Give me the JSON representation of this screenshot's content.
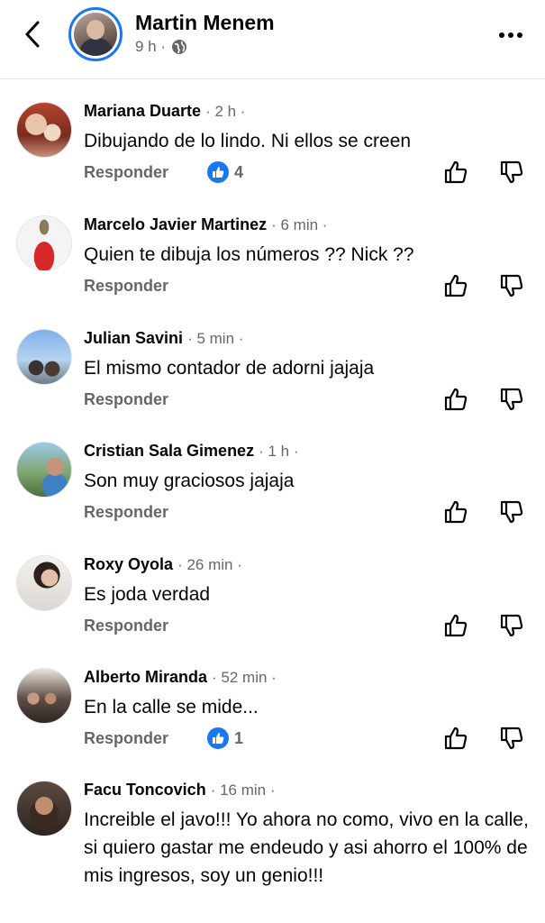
{
  "header": {
    "name": "Martin Menem",
    "time": "9 h ·",
    "audience_icon": "globe-icon"
  },
  "colors": {
    "accent": "#1877f2",
    "muted": "#65676b",
    "text": "#050505"
  },
  "comments": [
    {
      "author": "Mariana Duarte",
      "time": "· 2 h ·",
      "text": "Dibujando de lo lindo.  Ni ellos se creen",
      "reply": "Responder",
      "reactions": "4"
    },
    {
      "author": "Marcelo Javier Martinez",
      "time": "· 6 min ·",
      "text": "Quien te dibuja los números ?? Nick ??",
      "reply": "Responder"
    },
    {
      "author": "Julian Savini",
      "time": "· 5 min ·",
      "text": "El mismo contador de adorni jajaja",
      "reply": "Responder"
    },
    {
      "author": "Cristian Sala Gimenez",
      "time": "· 1 h ·",
      "text": "Son muy graciosos jajaja",
      "reply": "Responder"
    },
    {
      "author": "Roxy Oyola",
      "time": "· 26 min ·",
      "text": "Es joda verdad",
      "reply": "Responder"
    },
    {
      "author": "Alberto Miranda",
      "time": "· 52 min ·",
      "text": "En la calle se mide...",
      "reply": "Responder",
      "reactions": "1"
    },
    {
      "author": "Facu Toncovich",
      "time": "· 16 min ·",
      "text": "Increible el javo!!! Yo ahora no como, vivo en la calle, si quiero gastar me endeudo y asi ahorro el 100% de mis ingresos, soy un genio!!!"
    }
  ]
}
